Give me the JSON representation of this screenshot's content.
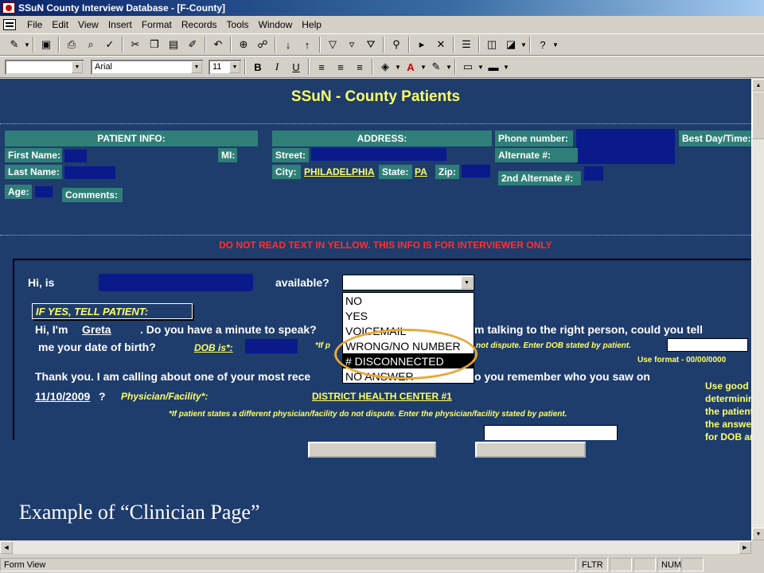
{
  "window": {
    "title": "SSuN County Interview Database - [F-County]"
  },
  "menu": [
    "File",
    "Edit",
    "View",
    "Insert",
    "Format",
    "Records",
    "Tools",
    "Window",
    "Help"
  ],
  "toolbar2": {
    "font": "Arial",
    "size": "11",
    "bold": "B",
    "italic": "I",
    "underline": "U"
  },
  "form": {
    "title": "SSuN - County Patients",
    "patient_info": "PATIENT INFO:",
    "first_name": "First Name:",
    "mi": "MI:",
    "last_name": "Last Name:",
    "age": "Age:",
    "comments": "Comments:",
    "address": "ADDRESS:",
    "street": "Street:",
    "city": "City:",
    "city_value": "PHILADELPHIA",
    "state": "State:",
    "state_value": "PA",
    "zip": "Zip:",
    "phone": "Phone number:",
    "alternate": "Alternate #:",
    "alternate2": "2nd Alternate #:",
    "best_day": "Best Day/Time:",
    "warning": "DO NOT READ TEXT IN YELLOW.  THIS INFO IS FOR INTERVIEWER ONLY",
    "hi_is": "Hi, is",
    "available": "available?",
    "if_yes": "IF YES, TELL PATIENT:",
    "hi_im": "Hi, I'm",
    "interviewer_name": "Greta",
    "minute": ". Do you have a minute to speak?",
    "right_person": "m talking to the right person, could you tell",
    "dob_line": "me your date of birth?",
    "dob_is": "DOB is*:",
    "if_p": "*If p",
    "not_dispute": "not dispute.  Enter DOB stated by patient.",
    "use_format": "Use format - 00/00/0000",
    "thank_you": "Thank you.  I am calling about one of your most rece",
    "remember": "o you remember who you saw on",
    "visit_date": "11/10/2009",
    "question_mark": "?",
    "physician": "Physician/Facility*:",
    "facility": "DISTRICT HEALTH CENTER #1",
    "physician_note": "*If patient states a different physician/facility do not dispute.  Enter the physician/facility stated by patient.",
    "side_note": [
      "Use good j",
      "determinin",
      "the patient",
      "the answe",
      "for DOB an"
    ],
    "dropdown_options": [
      "NO",
      "YES",
      "VOICEMAIL",
      "WRONG/NO NUMBER",
      "# DISCONNECTED",
      "NO ANSWER"
    ],
    "selected_option": "# DISCONNECTED",
    "caption": "Example of “Clinician Page”"
  },
  "status": {
    "view": "Form View",
    "fltr": "FLTR",
    "num": "NUM"
  },
  "colors": {
    "form_bg": "#1e3c6c",
    "label_bg": "#2f7f78",
    "yellow_text": "#ffff66",
    "warning_red": "#ff3030",
    "highlight_ring": "#e8a838"
  }
}
